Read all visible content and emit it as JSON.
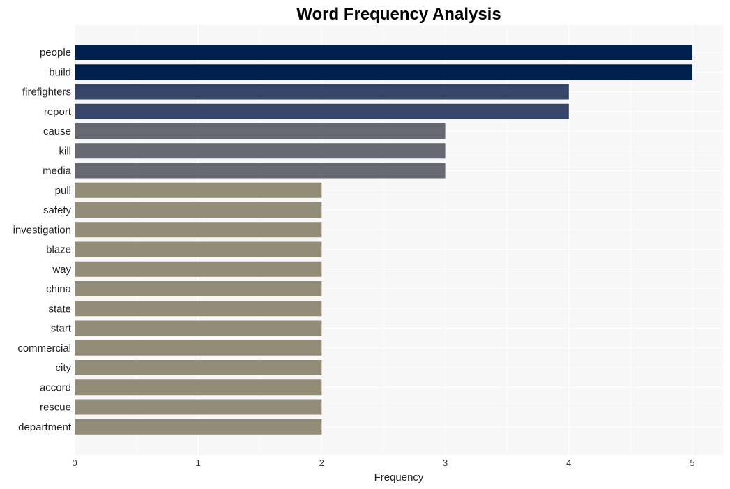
{
  "chart_data": {
    "type": "bar",
    "orientation": "horizontal",
    "title": "Word Frequency Analysis",
    "xlabel": "Frequency",
    "ylabel": "",
    "xlim": [
      0,
      5.2
    ],
    "xticks": [
      0,
      1,
      2,
      3,
      4,
      5
    ],
    "grid": true,
    "legend": "none",
    "categories": [
      "people",
      "build",
      "firefighters",
      "report",
      "cause",
      "kill",
      "media",
      "pull",
      "safety",
      "investigation",
      "blaze",
      "way",
      "china",
      "state",
      "start",
      "commercial",
      "city",
      "accord",
      "rescue",
      "department"
    ],
    "values": [
      5,
      5,
      4,
      4,
      3,
      3,
      3,
      2,
      2,
      2,
      2,
      2,
      2,
      2,
      2,
      2,
      2,
      2,
      2,
      2
    ],
    "color_by_value": {
      "5": "#00214d",
      "4": "#37456b",
      "3": "#676972",
      "2": "#938c77"
    },
    "panel_background": "#f7f7f7"
  }
}
